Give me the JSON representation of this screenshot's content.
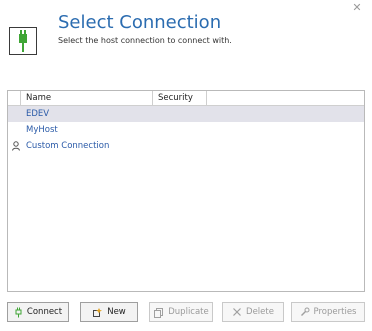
{
  "dialog": {
    "title": "Select Connection",
    "subtitle": "Select the host connection to connect with."
  },
  "list": {
    "columns": {
      "name": "Name",
      "security": "Security"
    },
    "rows": [
      {
        "name": "EDEV",
        "security": "",
        "selected": true,
        "icon": ""
      },
      {
        "name": "MyHost",
        "security": "",
        "selected": false,
        "icon": ""
      },
      {
        "name": "Custom Connection",
        "security": "",
        "selected": false,
        "icon": "user-icon"
      }
    ]
  },
  "buttons": {
    "connect": "Connect",
    "new": "New",
    "duplicate": "Duplicate",
    "delete": "Delete",
    "properties": "Properties"
  },
  "colors": {
    "title": "#2b6cb0",
    "link": "#2a5aa8",
    "plug": "#3fa535",
    "selected_row": "#e2e2ea"
  }
}
